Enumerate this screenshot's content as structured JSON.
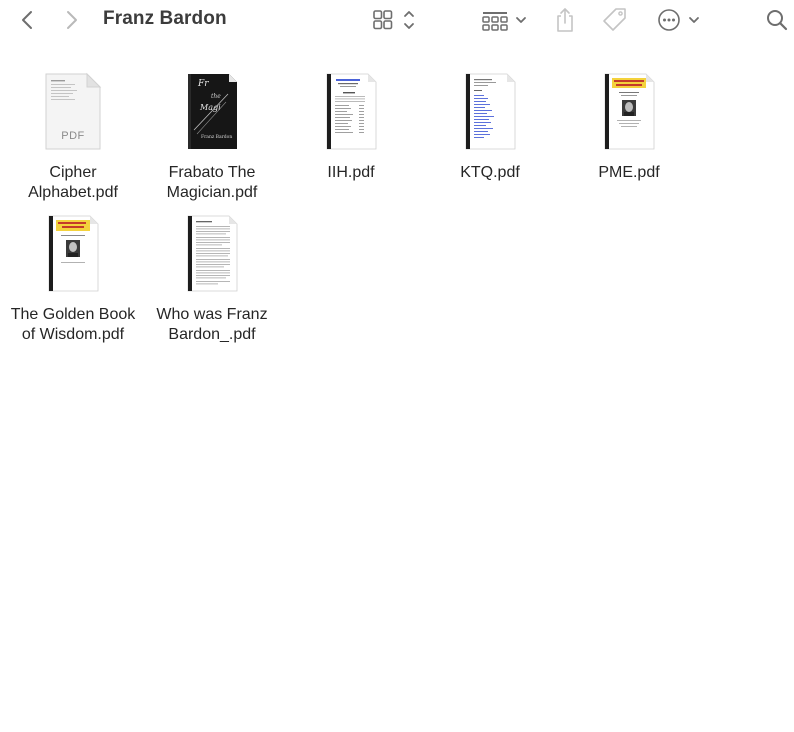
{
  "window": {
    "title": "Franz Bardon"
  },
  "toolbar": {
    "icons": [
      "back-chevron-icon",
      "forward-chevron-icon",
      "view-grid-icon",
      "group-by-icon",
      "share-icon",
      "tag-icon",
      "more-actions-icon",
      "search-icon"
    ]
  },
  "files": [
    {
      "name": "Cipher Alphabet.pdf",
      "line1": "Cipher",
      "line2": "Alphabet.pdf",
      "kind": "generic-pdf",
      "badge": "PDF"
    },
    {
      "name": "Frabato The Magician.pdf",
      "line1": "Frabato The",
      "line2": "Magician.pdf",
      "kind": "dark-cover"
    },
    {
      "name": "IIH.pdf",
      "line1": "IIH.pdf",
      "line2": "",
      "kind": "text-doc"
    },
    {
      "name": "KTQ.pdf",
      "line1": "KTQ.pdf",
      "line2": "",
      "kind": "link-doc"
    },
    {
      "name": "PME.pdf",
      "line1": "PME.pdf",
      "line2": "",
      "kind": "portrait-doc"
    },
    {
      "name": "The Golden Book of Wisdom.pdf",
      "line1": "The Golden Book",
      "line2": "of Wisdom.pdf",
      "kind": "portrait-doc"
    },
    {
      "name": "Who was Franz Bardon_.pdf",
      "line1": "Who was Franz",
      "line2": "Bardon_.pdf",
      "kind": "article-doc"
    }
  ],
  "colors": {
    "toolbar_icon": "#7a7a7a",
    "toolbar_icon_disabled": "#c4c4c4",
    "title": "#3c3c3c",
    "label": "#262626",
    "pdf_badge": "#8a8a8a",
    "cover_dark": "#161616",
    "banner_yellow": "#f4d23c",
    "banner_red": "#c43b2a",
    "link_blue": "#4a62d8"
  }
}
